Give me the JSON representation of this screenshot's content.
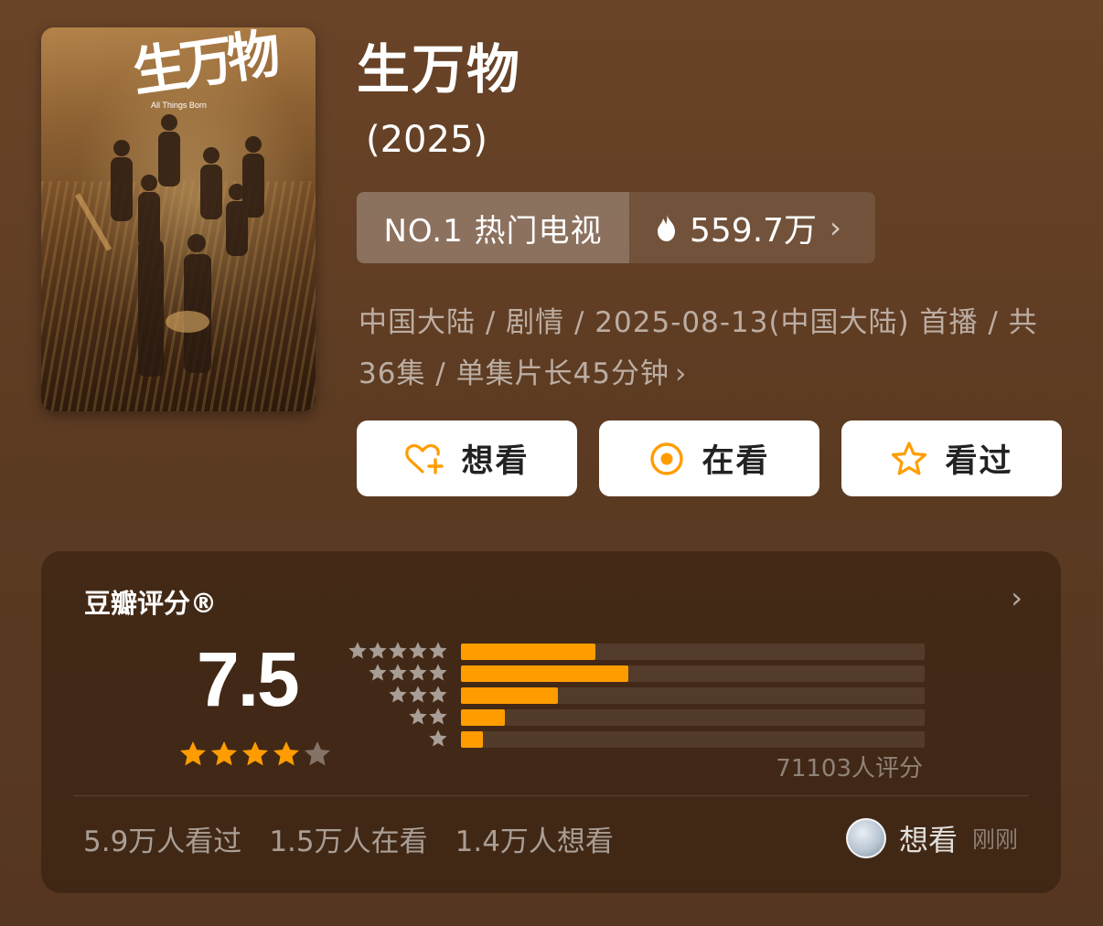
{
  "poster": {
    "logo_text": "生万物",
    "logo_subtitle": "All Things Born"
  },
  "movie": {
    "title": "生万物",
    "year": "(2025)"
  },
  "ranking": {
    "label": "NO.1 热门电视",
    "heat": "559.7万"
  },
  "meta": {
    "line1": "中国大陆 / 剧情 / 2025-08-13(中国大陆) 首播 / 共",
    "line2": "36集 / 单集片长45分钟"
  },
  "actions": {
    "want": "想看",
    "watching": "在看",
    "watched": "看过"
  },
  "rating": {
    "title": "豆瓣评分®",
    "score": "7.5",
    "score_stars": 4,
    "distribution": [
      {
        "stars": 5,
        "fraction": 0.29
      },
      {
        "stars": 4,
        "fraction": 0.36
      },
      {
        "stars": 3,
        "fraction": 0.21
      },
      {
        "stars": 2,
        "fraction": 0.095
      },
      {
        "stars": 1,
        "fraction": 0.048
      }
    ],
    "count": "71103人评分"
  },
  "stats": {
    "watched": "5.9万人看过",
    "watching": "1.5万人在看",
    "want": "1.4万人想看"
  },
  "activity": {
    "label": "想看",
    "time": "刚刚"
  },
  "colors": {
    "accent": "#ff9d00",
    "background": "#5c3b22"
  }
}
